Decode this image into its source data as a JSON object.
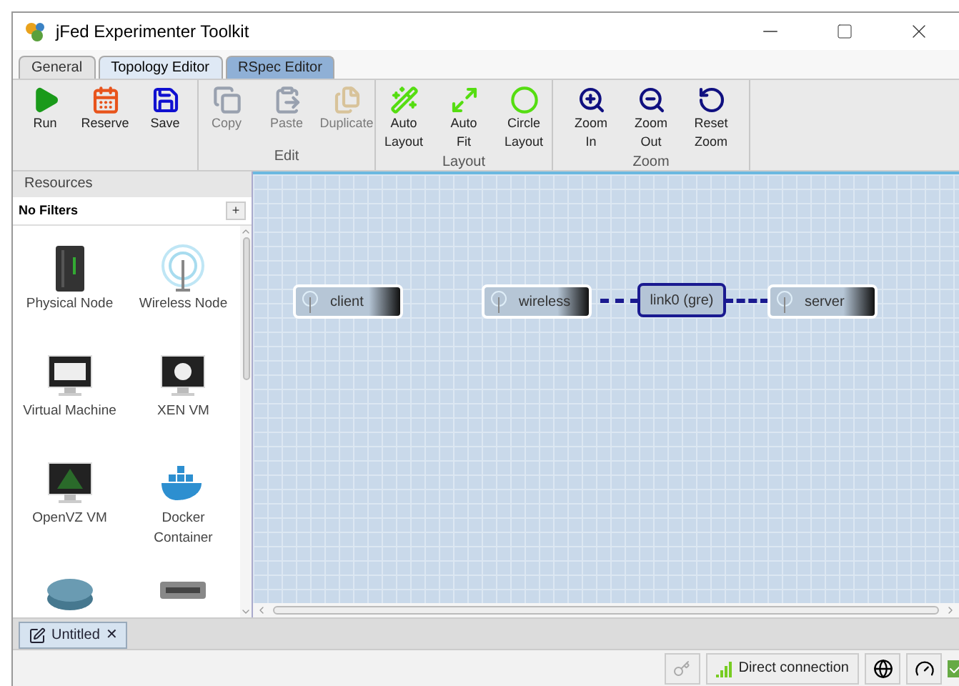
{
  "window": {
    "title": "jFed Experimenter Toolkit"
  },
  "tabs": [
    {
      "label": "General",
      "selected": false
    },
    {
      "label": "Topology Editor",
      "selected": true
    },
    {
      "label": "RSpec Editor",
      "selected": false
    }
  ],
  "toolbar": [
    {
      "buttons": [
        {
          "label": "Run",
          "disabled": false
        },
        {
          "label": "Reserve",
          "disabled": false
        },
        {
          "label": "Save",
          "disabled": false
        }
      ]
    },
    {
      "label": "Edit",
      "buttons": [
        {
          "label": "Copy",
          "disabled": true
        },
        {
          "label": "Paste",
          "disabled": true
        },
        {
          "label": "Duplicate",
          "disabled": true
        }
      ]
    },
    {
      "label": "Layout",
      "buttons": [
        {
          "label": "Auto\nLayout",
          "disabled": false
        },
        {
          "label": "Auto\nFit",
          "disabled": false
        },
        {
          "label": "Circle\nLayout",
          "disabled": false
        }
      ]
    },
    {
      "label": "Zoom",
      "buttons": [
        {
          "label": "Zoom\nIn",
          "disabled": false
        },
        {
          "label": "Zoom\nOut",
          "disabled": false
        },
        {
          "label": "Reset\nZoom",
          "disabled": false
        }
      ]
    }
  ],
  "resources": {
    "title": "Resources",
    "filter": "No Filters",
    "add_button": "+",
    "items": [
      {
        "label": "Physical Node"
      },
      {
        "label": "Wireless Node"
      },
      {
        "label": "Virtual Machine"
      },
      {
        "label": "XEN VM"
      },
      {
        "label": "OpenVZ VM"
      },
      {
        "label": "Docker Container"
      },
      {
        "kind": "router"
      },
      {
        "kind": "switch"
      }
    ]
  },
  "canvas": {
    "nodes": [
      {
        "kind": "node",
        "label": "client",
        "selected": false
      },
      {
        "kind": "node",
        "label": "wireless",
        "selected": false
      },
      {
        "kind": "link",
        "label": "link0 (gre)",
        "selected": true
      },
      {
        "kind": "node",
        "label": "server",
        "selected": false
      }
    ]
  },
  "document_tabs": [
    {
      "label": "Untitled",
      "close": "✕"
    }
  ],
  "status_bar": {
    "connection": "Direct connection"
  }
}
